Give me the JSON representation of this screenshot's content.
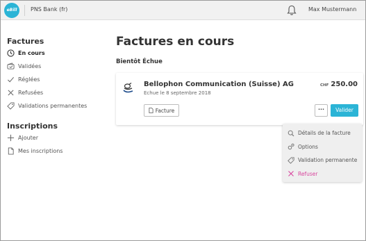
{
  "header": {
    "logo_text": "eBill",
    "bank_name": "PNS Bank (fr)",
    "user_name": "Max Mustermann",
    "accent": "#2bb4d6"
  },
  "sidebar": {
    "sections": [
      {
        "title": "Factures",
        "items": [
          {
            "label": "En cours",
            "icon": "clock-icon",
            "active": true
          },
          {
            "label": "Validées",
            "icon": "wallet-icon",
            "active": false
          },
          {
            "label": "Réglées",
            "icon": "check-icon",
            "active": false
          },
          {
            "label": "Refusées",
            "icon": "x-icon",
            "active": false
          },
          {
            "label": "Validations permanentes",
            "icon": "tag-icon",
            "active": false
          }
        ]
      },
      {
        "title": "Inscriptions",
        "items": [
          {
            "label": "Ajouter",
            "icon": "plus-icon",
            "active": false
          },
          {
            "label": "Mes inscriptions",
            "icon": "document-icon",
            "active": false
          }
        ]
      }
    ]
  },
  "main": {
    "title": "Factures en cours",
    "section_label": "Bientôt Échue",
    "bill": {
      "biller": "Bellophon Communication (Suisse) AG",
      "due": "Echue le 8 septembre 2018",
      "currency": "CHF",
      "amount": "250.00",
      "facture_label": "Facture",
      "more_label": "···",
      "valider_label": "Valider"
    }
  },
  "menu": {
    "items": [
      {
        "label": "Détails de la facture",
        "icon": "magnifier-icon"
      },
      {
        "label": "Options",
        "icon": "gears-icon"
      },
      {
        "label": "Validation permanente",
        "icon": "tag-icon"
      },
      {
        "label": "Refuser",
        "icon": "x-icon",
        "danger_color": "#d8469e"
      }
    ]
  }
}
